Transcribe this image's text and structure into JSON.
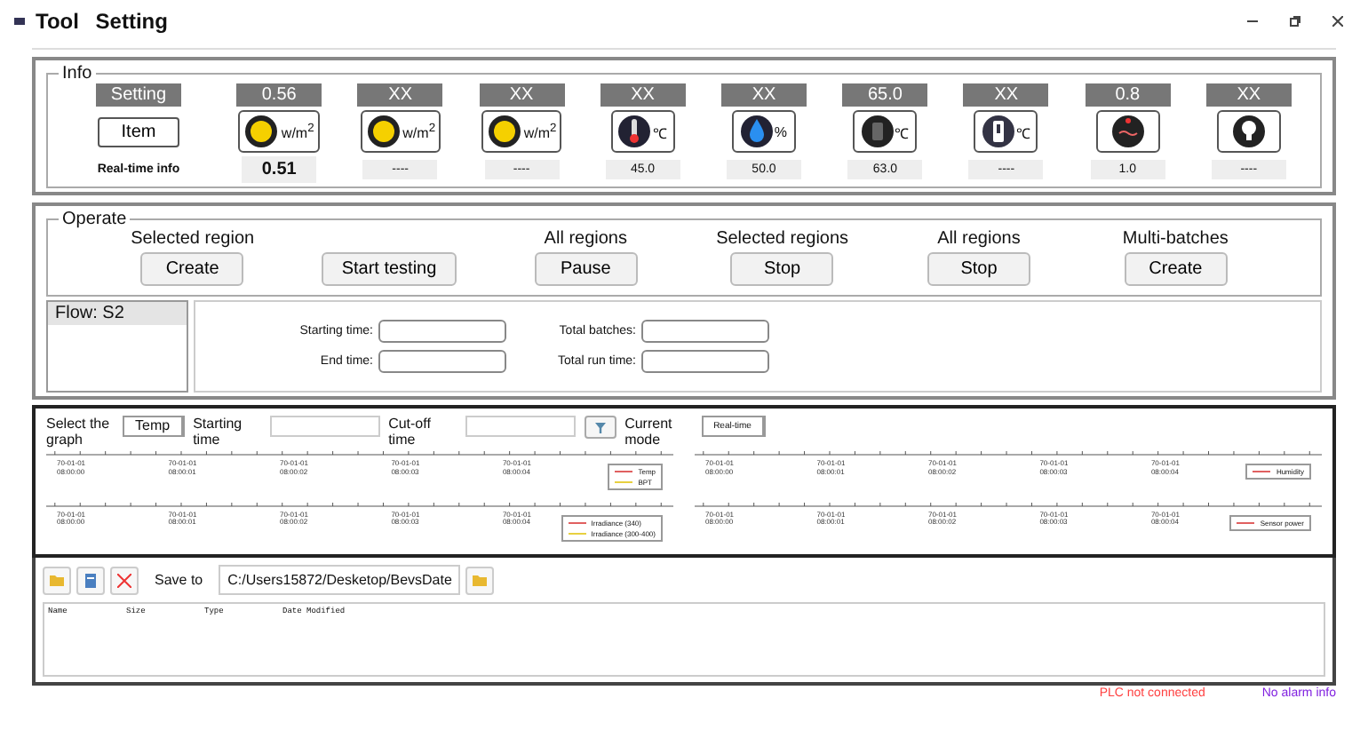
{
  "window": {
    "title": "Tool Setting"
  },
  "info": {
    "legend": "Info",
    "header_label": "Setting",
    "item_button": "Item",
    "reading_label": "Real-time info",
    "sensors": [
      {
        "setting": "0.56",
        "kind": "sun",
        "unit": "w/m$^{2}$",
        "reading": "0.51"
      },
      {
        "setting": "XX",
        "kind": "sun",
        "unit": "w/m$^{2}$",
        "reading": "----"
      },
      {
        "setting": "XX",
        "kind": "sun",
        "unit": "w/m$^{2}$",
        "reading": "----"
      },
      {
        "setting": "XX",
        "kind": "thermometer",
        "unit": "℃",
        "reading": "45.0"
      },
      {
        "setting": "XX",
        "kind": "drop",
        "unit": "%",
        "reading": "50.0"
      },
      {
        "setting": "65.0",
        "kind": "panel",
        "unit": "℃",
        "reading": "63.0"
      },
      {
        "setting": "XX",
        "kind": "sensor",
        "unit": "℃",
        "reading": "----"
      },
      {
        "setting": "0.8",
        "kind": "gauge",
        "reading": "1.0"
      },
      {
        "setting": "XX",
        "kind": "bulb",
        "reading": "----"
      }
    ]
  },
  "operate": {
    "legend": "Operate",
    "actions": [
      {
        "caption": "Selected region",
        "button": "Create"
      },
      {
        "button": "Start testing"
      },
      {
        "caption": "All regions",
        "button": "Pause"
      },
      {
        "caption": "Selected regions",
        "button": "Stop"
      },
      {
        "caption": "All regions",
        "button": "Stop"
      },
      {
        "caption": "Multi-batches",
        "button": "Create"
      }
    ]
  },
  "flows": [
    {
      "label": "Flow: S2",
      "selected": true
    }
  ],
  "times": [
    {
      "label": "Starting time:"
    },
    {
      "label": "Total batches:"
    },
    {
      "label": "End time:"
    },
    {
      "label": "Total run time:"
    }
  ],
  "graph": {
    "select_label": "Select the graph",
    "select_value": "Temp",
    "start_label": "Starting time",
    "cutoff_label": "Cut-off time",
    "mode_label": "Current mode",
    "mode_value": "Real-time",
    "plots": [
      {
        "ticks": [
          {
            "date": "70-01-01",
            "time": "08:00:00"
          },
          {
            "date": "70-01-01",
            "time": "08:00:01"
          },
          {
            "date": "70-01-01",
            "time": "08:00:02"
          },
          {
            "date": "70-01-01",
            "time": "08:00:03"
          },
          {
            "date": "70-01-01",
            "time": "08:00:04"
          }
        ],
        "legend": [
          {
            "name": "Temp",
            "color": "#e06060"
          },
          {
            "name": "BPT",
            "color": "#e8d040"
          }
        ]
      },
      {
        "ticks": [
          {
            "date": "70-01-01",
            "time": "08:00:00"
          },
          {
            "date": "70-01-01",
            "time": "08:00:01"
          },
          {
            "date": "70-01-01",
            "time": "08:00:02"
          },
          {
            "date": "70-01-01",
            "time": "08:00:03"
          },
          {
            "date": "70-01-01",
            "time": "08:00:04"
          }
        ],
        "legend": [
          {
            "name": "Humidity",
            "color": "#e06060"
          }
        ]
      },
      {
        "ticks": [
          {
            "date": "70-01-01",
            "time": "08:00:00"
          },
          {
            "date": "70-01-01",
            "time": "08:00:01"
          },
          {
            "date": "70-01-01",
            "time": "08:00:02"
          },
          {
            "date": "70-01-01",
            "time": "08:00:03"
          },
          {
            "date": "70-01-01",
            "time": "08:00:04"
          }
        ],
        "legend": [
          {
            "name": "Irradiance (340)",
            "color": "#e06060"
          },
          {
            "name": "Irradiance (300-400)",
            "color": "#e8d040"
          }
        ]
      },
      {
        "ticks": [
          {
            "date": "70-01-01",
            "time": "08:00:00"
          },
          {
            "date": "70-01-01",
            "time": "08:00:01"
          },
          {
            "date": "70-01-01",
            "time": "08:00:02"
          },
          {
            "date": "70-01-01",
            "time": "08:00:03"
          },
          {
            "date": "70-01-01",
            "time": "08:00:04"
          }
        ],
        "legend": [
          {
            "name": "Sensor power",
            "color": "#e06060"
          }
        ]
      }
    ]
  },
  "files": {
    "save_label": "Save to",
    "path": "C:/Users15872/Desketop/BevsDate",
    "columns": [
      "Name",
      "Size",
      "Type",
      "Date Modified"
    ]
  },
  "status": [
    {
      "text": "PLC not connected",
      "color": "#ff4040"
    },
    {
      "text": "No alarm info",
      "color": "#8020e0"
    }
  ]
}
